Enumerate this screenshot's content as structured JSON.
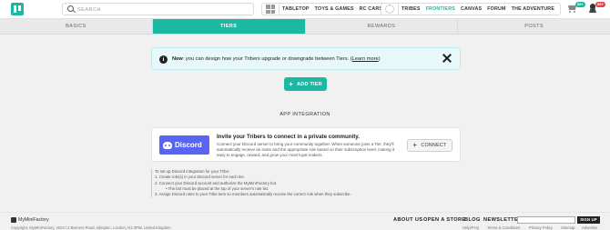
{
  "header": {
    "search_placeholder": "SEARCH",
    "nav_group_1": [
      "TABLETOP",
      "TOYS & GAMES",
      "RC CARS"
    ],
    "nav_group_2": [
      "TRIBES",
      "FRONTIERS",
      "CANVAS",
      "FORUM",
      "THE ADVENTURE"
    ],
    "active_nav": "FRONTIERS",
    "cart_badge": "99+",
    "notif_badge": "99+",
    "accent_color": "#1bb9a3"
  },
  "tabs": [
    "BASICS",
    "TIERS",
    "REWARDS",
    "POSTS"
  ],
  "active_tab": "TIERS",
  "notice": {
    "prefix": "New",
    "text": ": you can design how your Tribers upgrade or downgrade between Tiers. (",
    "link": "Learn more",
    "suffix": ")"
  },
  "add_tier_label": "ADD TIER",
  "app_integration_title": "APP INTEGRATION",
  "discord_card": {
    "brand": "Discord",
    "brand_color": "#5865f2",
    "title": "Invite your Tribers to connect in a private community.",
    "description": "Connect your Discord server to bring your community together. When someone joins a Tier, they'll automatically receive an invite and the appropriate role based on their subscription level, making it easy to engage, reward, and grow your most loyal makers.",
    "connect_label": "CONNECT"
  },
  "instructions": {
    "intro": "To set up Discord integration for your Tribe:",
    "steps": [
      "1. Create role(s) in your Discord server for each tier.",
      "2. Connect your Discord account and authorize the MyMiniFactory bot.",
      "3. Assign Discord roles to your Tribe tiers so members automatically receive the correct role when they subscribe."
    ],
    "sub_step": "The bot must be placed at the top of your server's role list."
  },
  "footer": {
    "brand": "MyMiniFactory",
    "copyright": "Copyright, MyMiniFactory, 2024 / 2 Berners Road, Islington, London, N1 0PW, United Kingdom",
    "links": [
      "ABOUT US",
      "OPEN A STORE",
      "BLOG",
      "NEWSLETTER"
    ],
    "signup_label": "SIGN UP",
    "small_links": [
      "Help/FAQ",
      "Terms & Conditions",
      "Privacy Policy",
      "Sitemap",
      "Advertise"
    ]
  }
}
